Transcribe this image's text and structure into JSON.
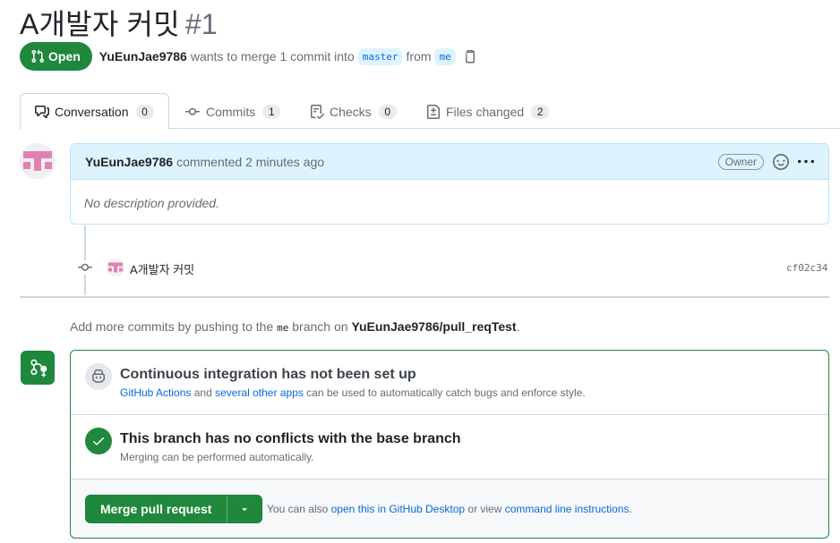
{
  "pr": {
    "title": "A개발자 커밋",
    "number": "#1",
    "state": "Open",
    "author": "YuEunJae9786",
    "action_text": "wants to merge 1 commit into",
    "base_branch": "master",
    "from_text": "from",
    "head_branch": "me"
  },
  "tabs": [
    {
      "label": "Conversation",
      "count": "0",
      "icon": "comment-discussion-icon"
    },
    {
      "label": "Commits",
      "count": "1",
      "icon": "git-commit-icon"
    },
    {
      "label": "Checks",
      "count": "0",
      "icon": "checklist-icon"
    },
    {
      "label": "Files changed",
      "count": "2",
      "icon": "file-diff-icon"
    }
  ],
  "comment": {
    "author": "YuEunJae9786",
    "time_text": "commented 2 minutes ago",
    "role_badge": "Owner",
    "body": "No description provided."
  },
  "commit": {
    "message": "A개발자 커밋",
    "sha": "cf02c34"
  },
  "hint": {
    "prefix": "Add more commits by pushing to the",
    "branch": "me",
    "middle": "branch on",
    "repo": "YuEunJae9786/pull_reqTest",
    "suffix": "."
  },
  "merge_box": {
    "ci": {
      "title": "Continuous integration has not been set up",
      "link1": "GitHub Actions",
      "and_text": "and",
      "link2": "several other apps",
      "rest": "can be used to automatically catch bugs and enforce style."
    },
    "conflicts": {
      "title": "This branch has no conflicts with the base branch",
      "subtitle": "Merging can be performed automatically."
    },
    "merge_button": "Merge pull request",
    "note_prefix": "You can also",
    "note_link1": "open this in GitHub Desktop",
    "note_mid": "or view",
    "note_link2": "command line instructions",
    "note_suffix": "."
  },
  "colors": {
    "accent_green": "#1f883d",
    "link_blue": "#0969da",
    "comment_header_bg": "#ddf4ff"
  }
}
